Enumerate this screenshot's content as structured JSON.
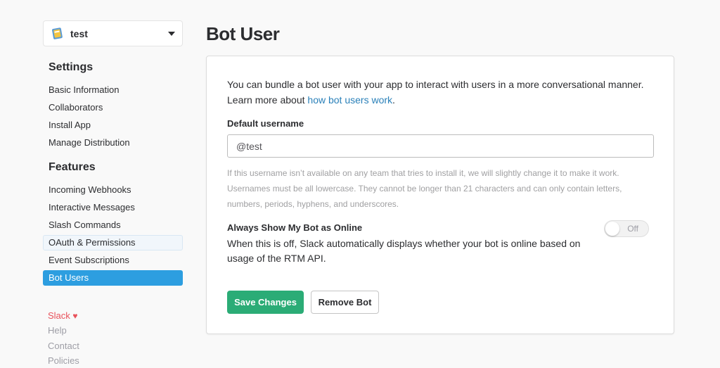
{
  "app_picker": {
    "name": "test"
  },
  "sidebar": {
    "settings_heading": "Settings",
    "settings_items": [
      {
        "label": "Basic Information"
      },
      {
        "label": "Collaborators"
      },
      {
        "label": "Install App"
      },
      {
        "label": "Manage Distribution"
      }
    ],
    "features_heading": "Features",
    "features_items": [
      {
        "label": "Incoming Webhooks",
        "state": "normal"
      },
      {
        "label": "Interactive Messages",
        "state": "normal"
      },
      {
        "label": "Slash Commands",
        "state": "normal"
      },
      {
        "label": "OAuth & Permissions",
        "state": "hover"
      },
      {
        "label": "Event Subscriptions",
        "state": "normal"
      },
      {
        "label": "Bot Users",
        "state": "active"
      }
    ],
    "footer": {
      "brand": "Slack",
      "heart": "♥",
      "help": "Help",
      "contact": "Contact",
      "policies": "Policies"
    }
  },
  "main": {
    "title": "Bot User",
    "intro_text": "You can bundle a bot user with your app to interact with users in a more conversational manner. Learn more about ",
    "intro_link": "how bot users work",
    "intro_end": ".",
    "username_label": "Default username",
    "username_placeholder": "@test",
    "username_value": "",
    "hint": "If this username isn’t available on any team that tries to install it, we will slightly change it to make it work. Usernames must be all lowercase. They cannot be longer than 21 characters and can only contain letters, numbers, periods, hyphens, and underscores.",
    "online_title": "Always Show My Bot as Online",
    "online_desc": "When this is off, Slack automatically displays whether your bot is online based on usage of the RTM API.",
    "toggle_label": "Off",
    "save_label": "Save Changes",
    "remove_label": "Remove Bot"
  },
  "colors": {
    "active_nav": "#2d9ee0",
    "save_button": "#2bac76",
    "link": "#2a80b9",
    "brand": "#e8525b"
  }
}
